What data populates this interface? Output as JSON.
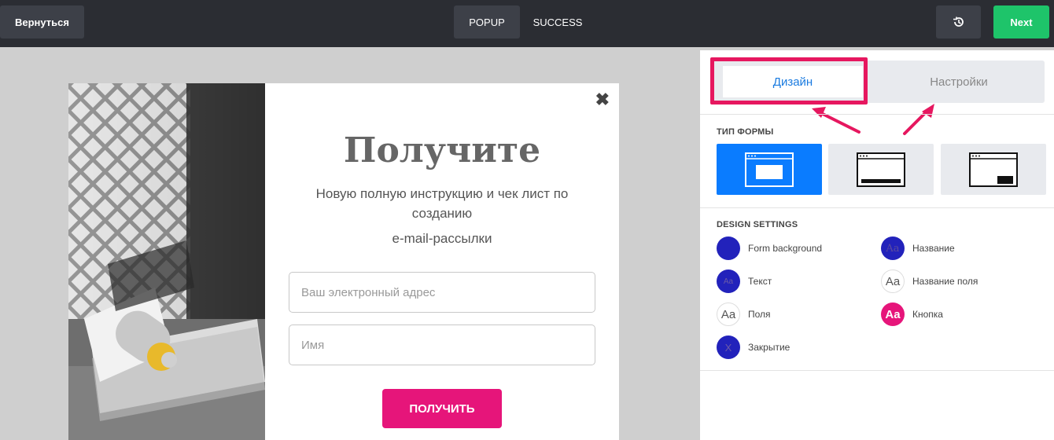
{
  "topbar": {
    "back_label": "Вернуться",
    "tabs": [
      {
        "label": "POPUP",
        "active": true
      },
      {
        "label": "SUCCESS",
        "active": false
      }
    ],
    "history_icon": "history-icon",
    "next_label": "Next"
  },
  "popup": {
    "heading": "Получите",
    "subtext": "Новую  полную инструкцию и чек лист по созданию",
    "subtext2": "e-mail-рассылки",
    "email_placeholder": "Ваш электронный адрес",
    "name_placeholder": "Имя",
    "submit_label": "ПОЛУЧИТЬ",
    "close_symbol": "✖"
  },
  "panel": {
    "tabs": [
      {
        "label": "Дизайн",
        "active": true
      },
      {
        "label": "Настройки",
        "active": false
      }
    ],
    "form_type_title": "ТИП ФОРМЫ",
    "design_settings_title": "DESIGN SETTINGS",
    "design_settings": [
      {
        "label": "Form background",
        "swatch_color": "#2222bb",
        "glyph": ""
      },
      {
        "label": "Название",
        "swatch_color": "#2222bb",
        "glyph": "Aa"
      },
      {
        "label": "Текст",
        "swatch_color": "#2222bb",
        "glyph": "Aa"
      },
      {
        "label": "Название поля",
        "swatch_color": "#ffffff",
        "glyph": "Aa"
      },
      {
        "label": "Поля",
        "swatch_color": "#ffffff",
        "glyph": "Aa"
      },
      {
        "label": "Кнопка",
        "swatch_color": "#e6157a",
        "glyph": "Aa"
      },
      {
        "label": "Закрытие",
        "swatch_color": "#2222bb",
        "glyph": "X"
      }
    ]
  },
  "colors": {
    "topbar": "#2b2d33",
    "accent_blue": "#0a7cff",
    "next_green": "#1ec46a",
    "button_pink": "#e6157a",
    "highlight": "#e6175f"
  }
}
